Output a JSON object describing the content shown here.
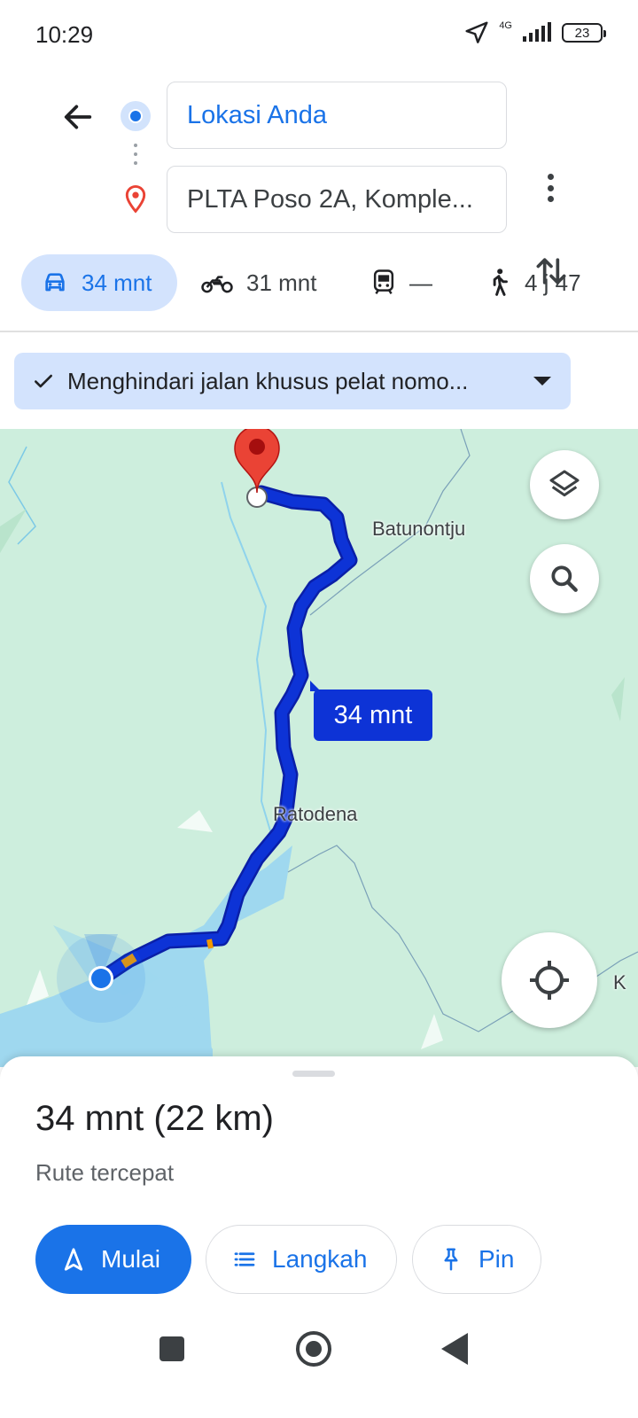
{
  "status_bar": {
    "time": "10:29",
    "network": "4G",
    "battery": "23"
  },
  "search": {
    "origin": "Lokasi Anda",
    "destination": "PLTA Poso 2A, Komple..."
  },
  "modes": [
    {
      "icon": "car-icon",
      "label": "34 mnt",
      "active": true
    },
    {
      "icon": "motorcycle-icon",
      "label": "31 mnt"
    },
    {
      "icon": "transit-icon",
      "label": "—"
    },
    {
      "icon": "walk-icon",
      "label": "4 j 47"
    }
  ],
  "route_option": {
    "label": "Menghindari jalan khusus pelat nomo..."
  },
  "map": {
    "places": [
      "Batunontju",
      "Ratodena",
      "K"
    ],
    "eta_label": "34 mnt",
    "route_color": "#0d33d6",
    "water_color": "#9fd8ef",
    "land_color": "#cdeedd"
  },
  "summary": {
    "title": "34 mnt (22 km)",
    "subtitle": "Rute tercepat"
  },
  "actions": {
    "start": "Mulai",
    "steps": "Langkah",
    "pin": "Pin"
  },
  "colors": {
    "accent": "#1a73e8",
    "chip_bg": "#d3e3fd",
    "destination_pin": "#ea4335"
  }
}
